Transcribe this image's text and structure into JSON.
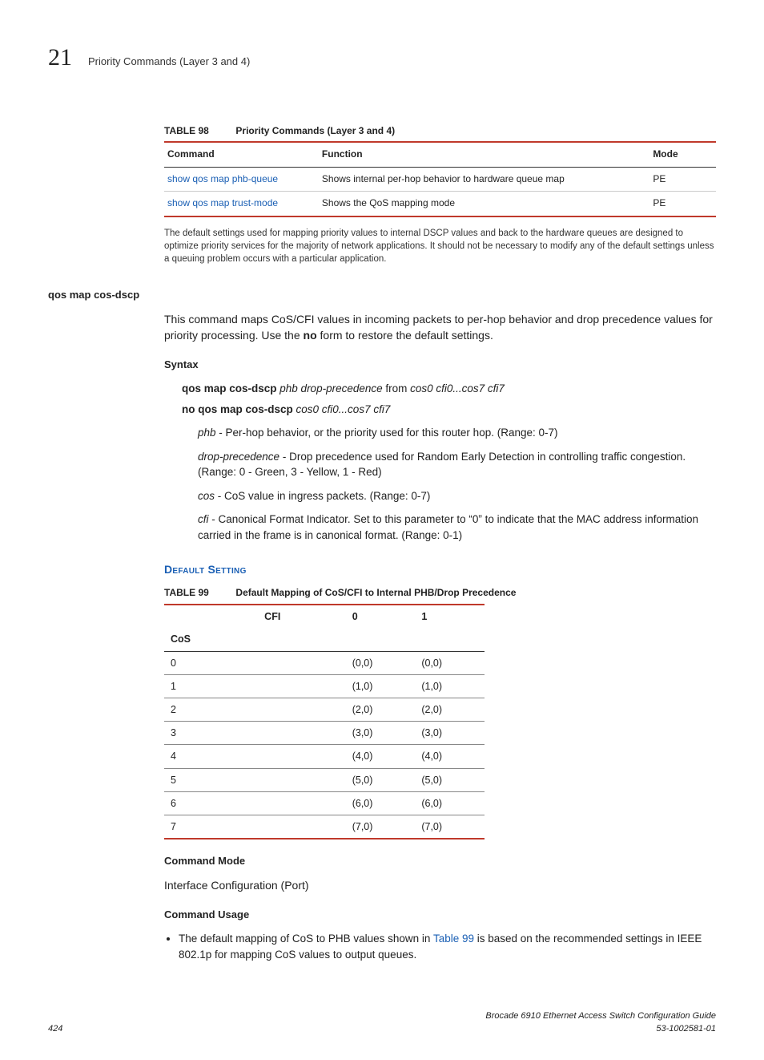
{
  "header": {
    "chapter_number": "21",
    "chapter_title": "Priority Commands (Layer 3 and 4)"
  },
  "table98": {
    "label": "TABLE 98",
    "title": "Priority Commands (Layer 3 and 4)",
    "headers": {
      "c1": "Command",
      "c2": "Function",
      "c3": "Mode"
    },
    "rows": [
      {
        "cmd": "show qos map phb-queue",
        "func": "Shows internal per-hop behavior to hardware queue map",
        "mode": "PE"
      },
      {
        "cmd": "show qos map trust-mode",
        "func": "Shows the QoS mapping mode",
        "mode": "PE"
      }
    ]
  },
  "note": "The default settings used for mapping priority values to internal DSCP values and back to the hardware queues are designed to optimize priority services for the majority of network applications. It should not be necessary to modify any of the default settings unless a queuing problem occurs with a particular application.",
  "section": {
    "name": "qos map cos-dscp",
    "desc_pre": "This command maps CoS/CFI values in incoming packets to per-hop behavior and drop precedence values for priority processing. Use the ",
    "desc_bold": "no",
    "desc_post": " form to restore the default settings."
  },
  "syntax": {
    "heading": "Syntax",
    "line1_b": "qos map cos-dscp ",
    "line1_i": "phb drop-precedence",
    "line1_mid": " from ",
    "line1_i2": "cos0 cfi0...cos7 cfi7",
    "line2_b": "no qos map cos-dscp ",
    "line2_i": "cos0 cfi0...cos7 cfi7",
    "params": {
      "phb": {
        "term": "phb",
        "txt": " - Per-hop behavior, or the priority used for this router hop. (Range: 0-7)"
      },
      "drop": {
        "term": "drop-precedence",
        "txt": " - Drop precedence used for Random Early Detection in controlling traffic congestion. (Range: 0 - Green, 3 - Yellow, 1 - Red)"
      },
      "cos": {
        "term": "cos",
        "txt": " - CoS value in ingress packets. (Range: 0-7)"
      },
      "cfi": {
        "term": "cfi",
        "txt": " - Canonical Format Indicator. Set to this parameter to “0” to indicate that the MAC address information carried in the frame is in canonical format. (Range: 0-1)"
      }
    }
  },
  "default_setting_heading": "Default Setting",
  "table99": {
    "label": "TABLE 99",
    "title": "Default Mapping of CoS/CFI to Internal PHB/Drop Precedence",
    "hdr_cfi": "CFI",
    "hdr_cos": "CoS",
    "hdr_c0": "0",
    "hdr_c1": "1",
    "rows": [
      {
        "cos": "0",
        "v0": "(0,0)",
        "v1": "(0,0)"
      },
      {
        "cos": "1",
        "v0": "(1,0)",
        "v1": "(1,0)"
      },
      {
        "cos": "2",
        "v0": "(2,0)",
        "v1": "(2,0)"
      },
      {
        "cos": "3",
        "v0": "(3,0)",
        "v1": "(3,0)"
      },
      {
        "cos": "4",
        "v0": "(4,0)",
        "v1": "(4,0)"
      },
      {
        "cos": "5",
        "v0": "(5,0)",
        "v1": "(5,0)"
      },
      {
        "cos": "6",
        "v0": "(6,0)",
        "v1": "(6,0)"
      },
      {
        "cos": "7",
        "v0": "(7,0)",
        "v1": "(7,0)"
      }
    ]
  },
  "cmd_mode": {
    "heading": "Command Mode",
    "text": "Interface Configuration (Port)"
  },
  "cmd_usage": {
    "heading": "Command Usage",
    "bullet_pre": "The default mapping of CoS to PHB values shown in ",
    "bullet_link": "Table 99",
    "bullet_post": " is based on the recommended settings in IEEE 802.1p for mapping CoS values to output queues."
  },
  "footer": {
    "page": "424",
    "doc_title": "Brocade 6910 Ethernet Access Switch Configuration Guide",
    "doc_id": "53-1002581-01"
  }
}
